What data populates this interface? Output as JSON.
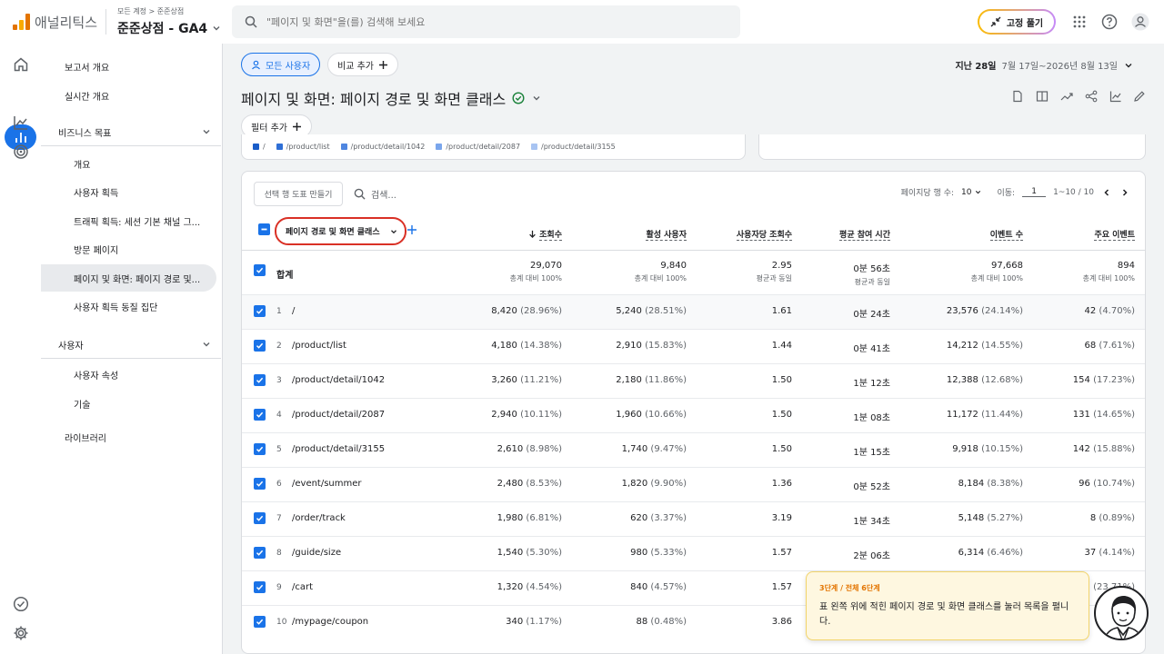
{
  "app": {
    "name": "애널리틱스",
    "breadcrumb": "모든 계정 > 준준상점",
    "property": "준준상점 - GA4",
    "search_placeholder": "\"페이지 및 화면\"을(를) 검색해 보세요",
    "pin_label": "고정 풀기"
  },
  "nav": {
    "reports_overview": "보고서 개요",
    "realtime": "실시간 개요",
    "section_business": "비즈니스 목표",
    "items": [
      "개요",
      "사용자 획득",
      "트래픽 획득: 세션 기본 채널 그...",
      "방문 페이지",
      "페이지 및 화면: 페이지 경로 및...",
      "사용자 획득 동질 집단"
    ],
    "section_user": "사용자",
    "user_items": [
      "사용자 속성",
      "기술"
    ],
    "library": "라이브러리"
  },
  "toolbar": {
    "all_users": "모든 사용자",
    "add_compare": "비교 추가",
    "date_label": "지난 28일",
    "date_range": "7월 17일~2026년 8월 13일",
    "page_title": "페이지 및 화면: 페이지 경로 및 화면 클래스",
    "add_filter": "필터 추가"
  },
  "legend": [
    "/",
    "/product/list",
    "/product/detail/1042",
    "/product/detail/2087",
    "/product/detail/3155"
  ],
  "colors": {
    "accent": "#1a73e8",
    "legend": [
      "#1a5dc8",
      "#2f6fd6",
      "#4f86e0",
      "#7aa6ec",
      "#a8c4f2"
    ],
    "highlight": "#d93025"
  },
  "table": {
    "make_chart": "선택 행 도표 만들기",
    "search": "검색...",
    "rows_per_page_label": "페이지당 행 수:",
    "rows_per_page": "10",
    "goto_label": "이동:",
    "goto_value": "1",
    "range": "1~10 / 10",
    "dimension": "페이지 경로 및 화면 클래스",
    "columns": [
      "조회수",
      "활성 사용자",
      "사용자당 조회수",
      "평균 참여 시간",
      "이벤트 수",
      "주요 이벤트"
    ],
    "total": {
      "label": "합계",
      "values": [
        "29,070",
        "9,840",
        "2.95",
        "0분 56초",
        "97,668",
        "894"
      ],
      "subs": [
        "총계 대비 100%",
        "총계 대비 100%",
        "평균과 동일",
        "평균과 동일",
        "총계 대비 100%",
        "총계 대비 100%"
      ]
    },
    "rows": [
      {
        "n": "1",
        "path": "/",
        "views": "8,420",
        "views_pct": "(28.96%)",
        "users": "5,240",
        "users_pct": "(28.51%)",
        "vpu": "1.61",
        "time": "0분 24초",
        "events": "23,576",
        "events_pct": "(24.14%)",
        "key": "42",
        "key_pct": "(4.70%)"
      },
      {
        "n": "2",
        "path": "/product/list",
        "views": "4,180",
        "views_pct": "(14.38%)",
        "users": "2,910",
        "users_pct": "(15.83%)",
        "vpu": "1.44",
        "time": "0분 41초",
        "events": "14,212",
        "events_pct": "(14.55%)",
        "key": "68",
        "key_pct": "(7.61%)"
      },
      {
        "n": "3",
        "path": "/product/detail/1042",
        "views": "3,260",
        "views_pct": "(11.21%)",
        "users": "2,180",
        "users_pct": "(11.86%)",
        "vpu": "1.50",
        "time": "1분 12초",
        "events": "12,388",
        "events_pct": "(12.68%)",
        "key": "154",
        "key_pct": "(17.23%)"
      },
      {
        "n": "4",
        "path": "/product/detail/2087",
        "views": "2,940",
        "views_pct": "(10.11%)",
        "users": "1,960",
        "users_pct": "(10.66%)",
        "vpu": "1.50",
        "time": "1분 08초",
        "events": "11,172",
        "events_pct": "(11.44%)",
        "key": "131",
        "key_pct": "(14.65%)"
      },
      {
        "n": "5",
        "path": "/product/detail/3155",
        "views": "2,610",
        "views_pct": "(8.98%)",
        "users": "1,740",
        "users_pct": "(9.47%)",
        "vpu": "1.50",
        "time": "1분 15초",
        "events": "9,918",
        "events_pct": "(10.15%)",
        "key": "142",
        "key_pct": "(15.88%)"
      },
      {
        "n": "6",
        "path": "/event/summer",
        "views": "2,480",
        "views_pct": "(8.53%)",
        "users": "1,820",
        "users_pct": "(9.90%)",
        "vpu": "1.36",
        "time": "0분 52초",
        "events": "8,184",
        "events_pct": "(8.38%)",
        "key": "96",
        "key_pct": "(10.74%)"
      },
      {
        "n": "7",
        "path": "/order/track",
        "views": "1,980",
        "views_pct": "(6.81%)",
        "users": "620",
        "users_pct": "(3.37%)",
        "vpu": "3.19",
        "time": "1분 34초",
        "events": "5,148",
        "events_pct": "(5.27%)",
        "key": "8",
        "key_pct": "(0.89%)"
      },
      {
        "n": "8",
        "path": "/guide/size",
        "views": "1,540",
        "views_pct": "(5.30%)",
        "users": "980",
        "users_pct": "(5.33%)",
        "vpu": "1.57",
        "time": "2분 06초",
        "events": "6,314",
        "events_pct": "(6.46%)",
        "key": "37",
        "key_pct": "(4.14%)"
      },
      {
        "n": "9",
        "path": "/cart",
        "views": "1,320",
        "views_pct": "(4.54%)",
        "users": "840",
        "users_pct": "(4.57%)",
        "vpu": "1.57",
        "time": "",
        "events": "",
        "events_pct": "",
        "key": "2",
        "key_pct": "(23.71%)"
      },
      {
        "n": "10",
        "path": "/mypage/coupon",
        "views": "340",
        "views_pct": "(1.17%)",
        "users": "88",
        "users_pct": "(0.48%)",
        "vpu": "3.86",
        "time": "",
        "events": "",
        "events_pct": "",
        "key": "",
        "key_pct": ""
      }
    ]
  },
  "tooltip": {
    "step": "3단계 / 전체 6단계",
    "message": "표 왼쪽 위에 적힌 페이지 경로 및 화면 클래스를 눌러 목록을 펼니다."
  }
}
